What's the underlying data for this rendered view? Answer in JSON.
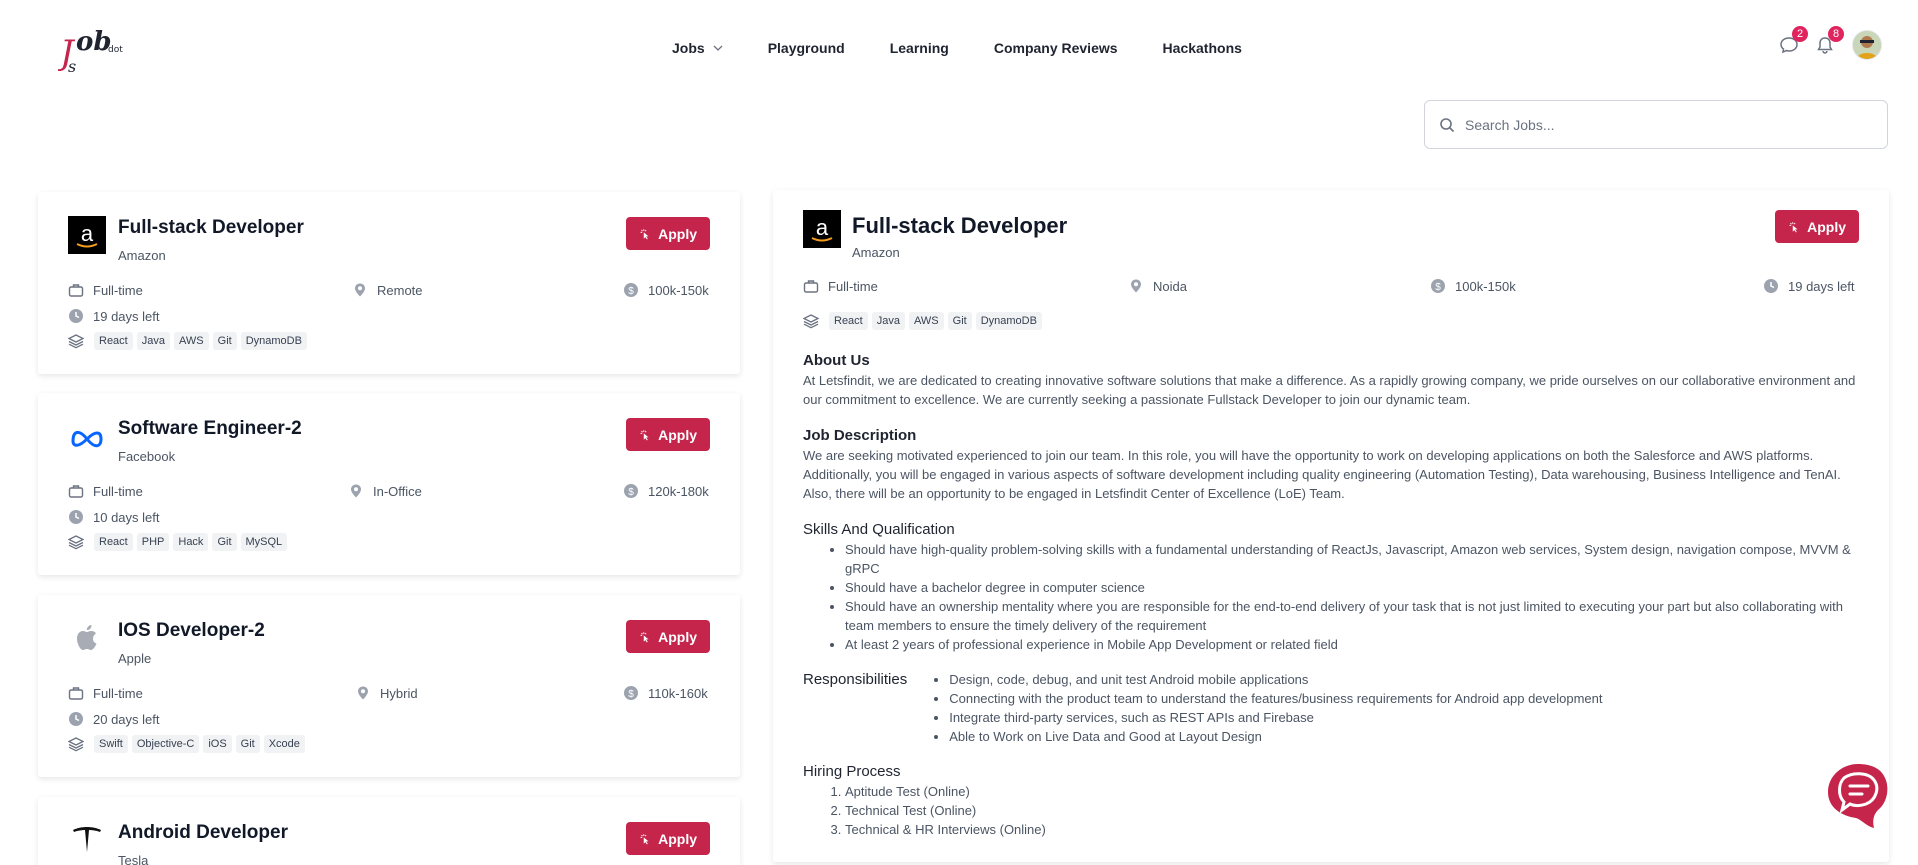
{
  "brand": {
    "logo_text": "Job",
    "logo_sub": "dot",
    "accent": "#c5244b"
  },
  "nav": {
    "items": [
      {
        "label": "Jobs",
        "has_dropdown": true
      },
      {
        "label": "Playground"
      },
      {
        "label": "Learning"
      },
      {
        "label": "Company Reviews"
      },
      {
        "label": "Hackathons"
      }
    ]
  },
  "header": {
    "messages_count": "2",
    "notifications_count": "8"
  },
  "search": {
    "placeholder": "Search Jobs..."
  },
  "jobs": [
    {
      "title": "Full-stack Developer",
      "company": "Amazon",
      "type": "Full-time",
      "location": "Remote",
      "salary": "100k-150k",
      "deadline": "19 days left",
      "tags": [
        "React",
        "Java",
        "AWS",
        "Git",
        "DynamoDB"
      ],
      "apply_label": "Apply",
      "logo_icon": "amazon-logo"
    },
    {
      "title": "Software Engineer-2",
      "company": "Facebook",
      "type": "Full-time",
      "location": "In-Office",
      "salary": "120k-180k",
      "deadline": "10 days left",
      "tags": [
        "React",
        "PHP",
        "Hack",
        "Git",
        "MySQL"
      ],
      "apply_label": "Apply",
      "logo_icon": "meta-logo"
    },
    {
      "title": "IOS Developer-2",
      "company": "Apple",
      "type": "Full-time",
      "location": "Hybrid",
      "salary": "110k-160k",
      "deadline": "20 days left",
      "tags": [
        "Swift",
        "Objective-C",
        "iOS",
        "Git",
        "Xcode"
      ],
      "apply_label": "Apply",
      "logo_icon": "apple-logo"
    },
    {
      "title": "Android Developer",
      "company": "Tesla",
      "apply_label": "Apply",
      "logo_icon": "tesla-logo"
    }
  ],
  "detail": {
    "title": "Full-stack Developer",
    "company": "Amazon",
    "apply_label": "Apply",
    "type": "Full-time",
    "location": "Noida",
    "salary": "100k-150k",
    "deadline": "19 days left",
    "tags": [
      "React",
      "Java",
      "AWS",
      "Git",
      "DynamoDB"
    ],
    "about_heading": "About Us",
    "about_text": "At Letsfindit, we are dedicated to creating innovative software solutions that make a difference. As a rapidly growing company, we pride ourselves on our collaborative environment and our commitment to excellence. We are currently seeking a passionate Fullstack Developer to join our dynamic team.",
    "desc_heading": "Job Description",
    "desc_text": "We are seeking motivated experienced to join our team. In this role, you will have the opportunity to work on developing applications on both the Salesforce and AWS platforms. Additionally, you will be engaged in various aspects of software development including quality engineering (Automation Testing), Data warehousing, Business Intelligence and TenAI. Also, there will be an opportunity to be engaged in Letsfindit Center of Excellence (LoE) Team.",
    "skills_heading": "Skills And Qualification",
    "skills": [
      "Should have high-quality problem-solving skills with a fundamental understanding of ReactJs, Javascript, Amazon web services, System design, navigation compose, MVVM & gRPC",
      "Should have a bachelor degree in computer science",
      "Should have an ownership mentality where you are responsible for the end-to-end delivery of your task that is not just limited to executing your part but also collaborating with team members to ensure the timely delivery of the requirement",
      "At least 2 years of professional experience in Mobile App Development or related field"
    ],
    "resp_heading": "Responsibilities",
    "responsibilities": [
      "Design, code, debug, and unit test Android mobile applications",
      "Connecting with the product team to understand the features/business requirements for Android app development",
      "Integrate third-party services, such as REST APIs and Firebase",
      "Able to Work on Live Data and Good at Layout Design"
    ],
    "hiring_heading": "Hiring Process",
    "hiring": [
      "Aptitude Test (Online)",
      "Technical Test (Online)",
      "Technical & HR Interviews (Online)"
    ]
  }
}
